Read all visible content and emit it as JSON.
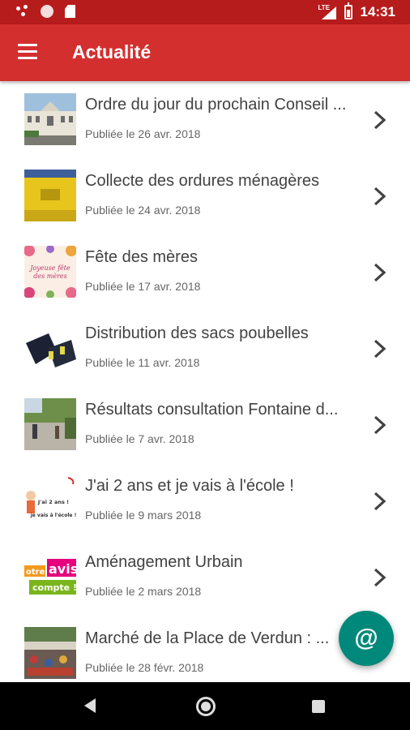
{
  "status_bar": {
    "time": "14:31",
    "network": "LTE"
  },
  "app_bar": {
    "title": "Actualité",
    "menu_icon": "hamburger-menu-icon"
  },
  "news_items": [
    {
      "title": "Ordre du jour du prochain Conseil ...",
      "date": "Publiée le 26 avr. 2018",
      "thumbnail": "town-hall-photo"
    },
    {
      "title": "Collecte des ordures ménagères",
      "date": "Publiée le 24 avr. 2018",
      "thumbnail": "yellow-bin-photo"
    },
    {
      "title": "Fête des mères",
      "date": "Publiée le 17 avr. 2018",
      "thumbnail": "flowers-card-image",
      "thumbnail_text": "Joyeuse fête des mères"
    },
    {
      "title": "Distribution des sacs poubelles",
      "date": "Publiée le 11 avr. 2018",
      "thumbnail": "trash-bags-photo"
    },
    {
      "title": "Résultats consultation Fontaine d...",
      "date": "Publiée le 7 avr. 2018",
      "thumbnail": "square-fountain-photo"
    },
    {
      "title": "J'ai 2 ans et je vais à l'école !",
      "date": "Publiée le 9 mars 2018",
      "thumbnail": "school-kid-illustration",
      "thumbnail_text": "J'ai 2 ans ! je vais à l'école !"
    },
    {
      "title": "Aménagement Urbain",
      "date": "Publiée le 2 mars 2018",
      "thumbnail": "avis-banner-image",
      "thumbnail_text": [
        "otre",
        "avis",
        "compte !"
      ]
    },
    {
      "title": "Marché de la Place de Verdun : ...",
      "date": "Publiée le 28 févr. 2018",
      "thumbnail": "market-photo"
    }
  ],
  "fab": {
    "icon": "at-sign-icon",
    "label": "@"
  },
  "colors": {
    "status_bar": "#b71c1c",
    "app_bar": "#d32f2f",
    "fab": "#00897b",
    "title_text": "#424242",
    "date_text": "#666666"
  }
}
